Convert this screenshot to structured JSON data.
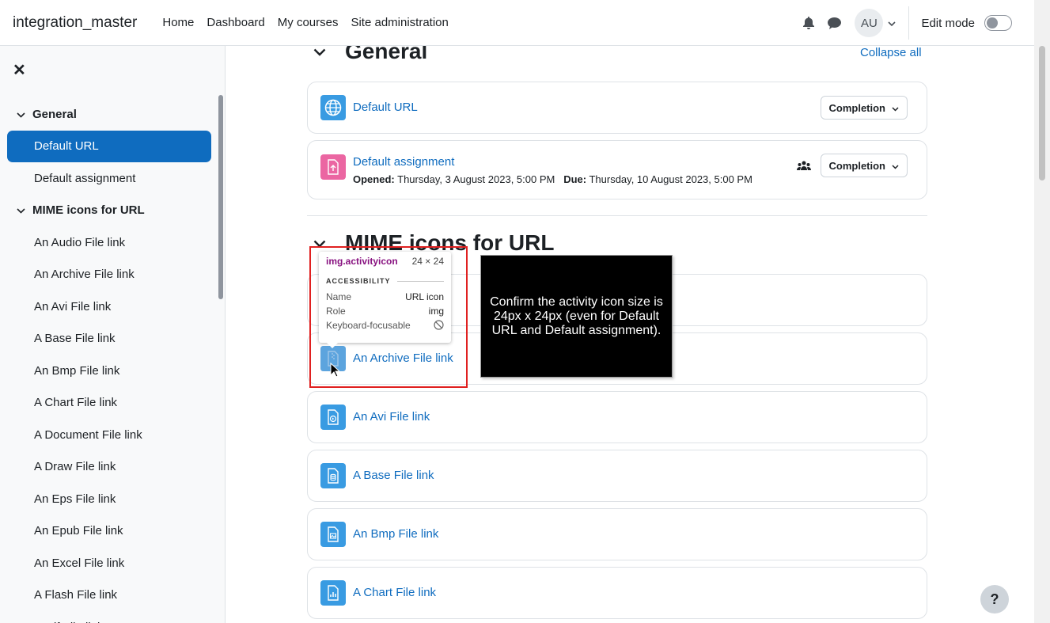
{
  "navbar": {
    "brand": "integration_master",
    "links": [
      "Home",
      "Dashboard",
      "My courses",
      "Site administration"
    ],
    "avatar_initials": "AU",
    "edit_mode_label": "Edit mode"
  },
  "drawer": {
    "items": [
      {
        "label": "General",
        "type": "section"
      },
      {
        "label": "Default URL",
        "type": "item",
        "active": true
      },
      {
        "label": "Default assignment",
        "type": "item"
      },
      {
        "label": "MIME icons for URL",
        "type": "section"
      },
      {
        "label": "An Audio File link",
        "type": "item"
      },
      {
        "label": "An Archive File link",
        "type": "item"
      },
      {
        "label": "An Avi File link",
        "type": "item"
      },
      {
        "label": "A Base File link",
        "type": "item"
      },
      {
        "label": "An Bmp File link",
        "type": "item"
      },
      {
        "label": "A Chart File link",
        "type": "item"
      },
      {
        "label": "A Document File link",
        "type": "item"
      },
      {
        "label": "A Draw File link",
        "type": "item"
      },
      {
        "label": "An Eps File link",
        "type": "item"
      },
      {
        "label": "An Epub File link",
        "type": "item"
      },
      {
        "label": "An Excel File link",
        "type": "item"
      },
      {
        "label": "A Flash File link",
        "type": "item"
      },
      {
        "label": "A Gif File link",
        "type": "item"
      }
    ]
  },
  "main": {
    "section1_title": "General",
    "collapse_all": "Collapse all",
    "section2_title": "MIME icons for URL",
    "completion_label": "Completion",
    "activities": {
      "default_url": "Default URL",
      "default_assignment": "Default assignment",
      "opened_label": "Opened:",
      "opened_value": "Thursday, 3 August 2023, 5:00 PM",
      "due_label": "Due:",
      "due_value": "Thursday, 10 August 2023, 5:00 PM",
      "archive": "An Archive File link",
      "avi": "An Avi File link",
      "base": "A Base File link",
      "bmp": "An Bmp File link",
      "chart": "A Chart File link"
    }
  },
  "inspector": {
    "selector": "img.activityicon",
    "size": "24 × 24",
    "section": "ACCESSIBILITY",
    "rows": [
      {
        "key": "Name",
        "value": "URL icon"
      },
      {
        "key": "Role",
        "value": "img"
      },
      {
        "key": "Keyboard-focusable",
        "value": ""
      }
    ]
  },
  "note": "Confirm the activity icon size is 24px x 24px (even for Default URL and Default assignment).",
  "help": "?",
  "colors": {
    "accent": "#0f6cbf",
    "url_icon": "#399be2",
    "assign_icon": "#eb66a2",
    "highlight": "#e02020"
  }
}
